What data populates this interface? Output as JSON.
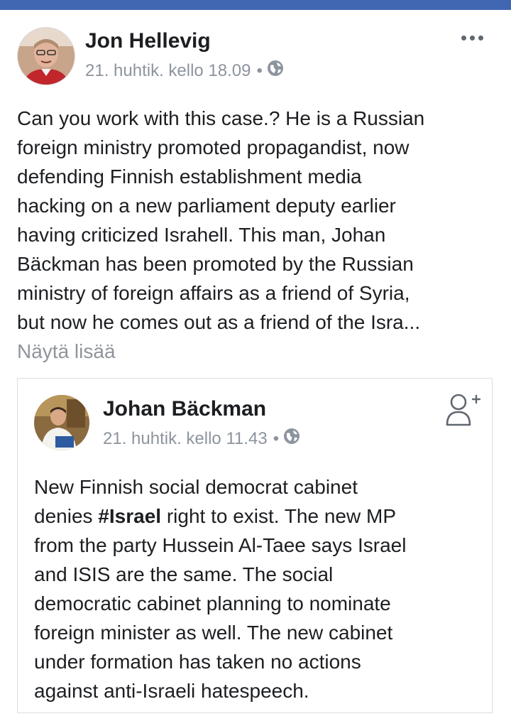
{
  "post": {
    "author": "Jon Hellevig",
    "time": "21. huhtik. kello 18.09",
    "dot": "•",
    "text_lines": [
      "Can you work with this case.? He is a Russian",
      "foreign ministry promoted propagandist, now",
      "defending Finnish establishment media",
      "hacking on a new parliament deputy earlier",
      "having criticized Israhell. This man, Johan",
      "Bäckman has been promoted by the Russian",
      "ministry of foreign affairs as a friend of Syria,",
      "but now he comes out as a friend of the Isra..."
    ],
    "see_more": "Näytä lisää"
  },
  "shared": {
    "author": "Johan Bäckman",
    "time": "21. huhtik. kello 11.43",
    "dot": "•",
    "line1": "New Finnish social democrat cabinet",
    "line2_before": "denies ",
    "hashtag": "#Israel",
    "line2_after": " right to exist. The new MP",
    "text_lines": [
      "from the party Hussein Al-Taee says Israel",
      "and ISIS are the same. The social",
      "democratic cabinet planning to nominate",
      "foreign minister as well. The new cabinet",
      "under formation has taken no actions",
      "against anti-Israeli hatespeech."
    ]
  },
  "icons": {
    "more": "more-options-icon",
    "privacy": "globe-icon",
    "add_friend": "add-friend-icon"
  },
  "colors": {
    "brand": "#4267b2",
    "text": "#1c1e21",
    "meta": "#8d949e",
    "see_more": "#90949c",
    "border": "#dadde1"
  }
}
